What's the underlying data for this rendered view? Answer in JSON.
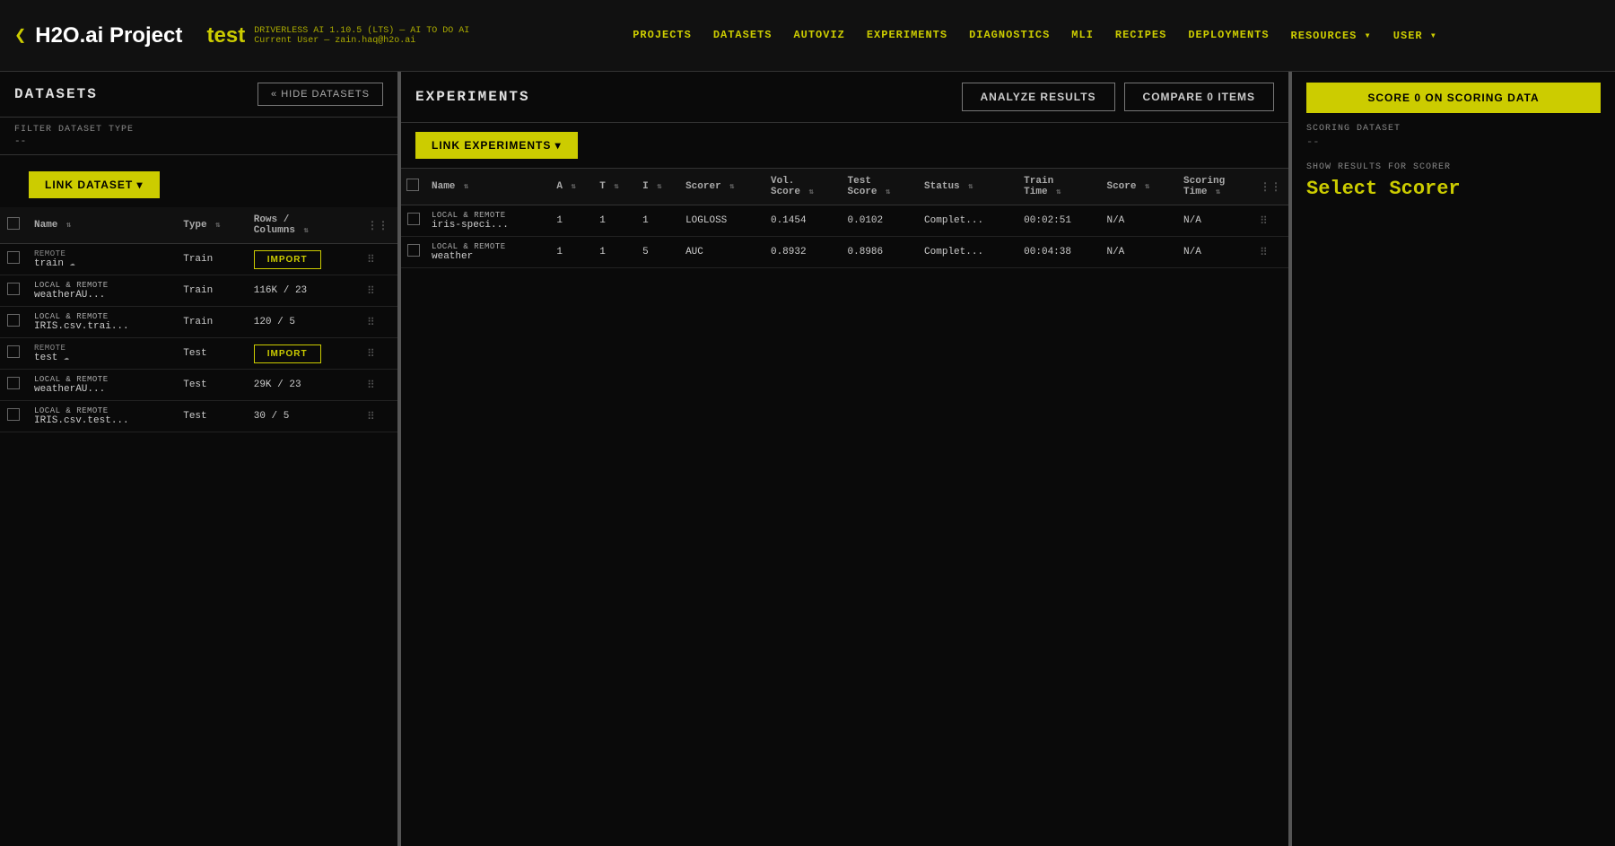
{
  "app": {
    "logo_chevron": "❮",
    "logo_text": "H2O.ai Project",
    "logo_project": "test",
    "subtitle_line1": "DRIVERLESS AI 1.10.5 (LTS) — AI TO DO AI",
    "subtitle_line2": "Current User — zain.haq@h2o.ai"
  },
  "nav": {
    "links": [
      "PROJECTS",
      "DATASETS",
      "AUTOVIZ",
      "EXPERIMENTS",
      "DIAGNOSTICS",
      "MLI",
      "RECIPES",
      "DEPLOYMENTS",
      "RESOURCES ▾",
      "USER ▾"
    ]
  },
  "datasets": {
    "panel_title": "DATASETS",
    "hide_btn": "« HIDE DATASETS",
    "filter_label": "FILTER DATASET TYPE",
    "filter_value": "--",
    "link_dataset_btn": "LINK DATASET ▾",
    "columns": {
      "name": "Name",
      "type": "Type",
      "rows_columns": "Rows / Columns",
      "options": ""
    },
    "rows": [
      {
        "badge": "REMOTE",
        "name": "train",
        "cloud": true,
        "type": "Train",
        "rows_columns": "",
        "import": true
      },
      {
        "badge": "LOCAL & REMOTE",
        "name": "weatherAU...",
        "cloud": false,
        "type": "Train",
        "rows_columns": "116K / 23",
        "import": false
      },
      {
        "badge": "LOCAL & REMOTE",
        "name": "IRIS.csv.trai...",
        "cloud": false,
        "type": "Train",
        "rows_columns": "120 / 5",
        "import": false
      },
      {
        "badge": "REMOTE",
        "name": "test",
        "cloud": true,
        "type": "Test",
        "rows_columns": "",
        "import": true
      },
      {
        "badge": "LOCAL & REMOTE",
        "name": "weatherAU...",
        "cloud": false,
        "type": "Test",
        "rows_columns": "29K / 23",
        "import": false
      },
      {
        "badge": "LOCAL & REMOTE",
        "name": "IRIS.csv.test...",
        "cloud": false,
        "type": "Test",
        "rows_columns": "30 / 5",
        "import": false
      }
    ]
  },
  "experiments": {
    "panel_title": "EXPERIMENTS",
    "analyze_btn": "ANALYZE RESULTS",
    "compare_btn": "COMPARE 0 ITEMS",
    "link_btn": "LINK EXPERIMENTS ▾",
    "columns": {
      "name": "Name",
      "a": "A",
      "t": "T",
      "i": "I",
      "scorer": "Scorer",
      "vol_score": "Vol. Score",
      "test_score": "Test Score",
      "status": "Status",
      "train_time": "Train Time",
      "score": "Score",
      "scoring_time": "Scoring Time"
    },
    "rows": [
      {
        "badge": "LOCAL & REMOTE",
        "name": "iris-speci...",
        "a": "1",
        "t": "1",
        "i": "1",
        "scorer": "LOGLOSS",
        "vol_score": "0.1454",
        "test_score": "0.0102",
        "status": "Complet...",
        "train_time": "00:02:51",
        "score": "N/A",
        "scoring_time": "N/A"
      },
      {
        "badge": "LOCAL & REMOTE",
        "name": "weather",
        "a": "1",
        "t": "1",
        "i": "5",
        "scorer": "AUC",
        "vol_score": "0.8932",
        "test_score": "0.8986",
        "status": "Complet...",
        "train_time": "00:04:38",
        "score": "N/A",
        "scoring_time": "N/A"
      }
    ]
  },
  "scoring": {
    "score_btn": "SCORE 0 ON SCORING DATA",
    "dataset_label": "SCORING DATASET",
    "dataset_value": "--",
    "show_results_label": "SHOW RESULTS FOR SCORER",
    "select_scorer": "Select Scorer"
  }
}
